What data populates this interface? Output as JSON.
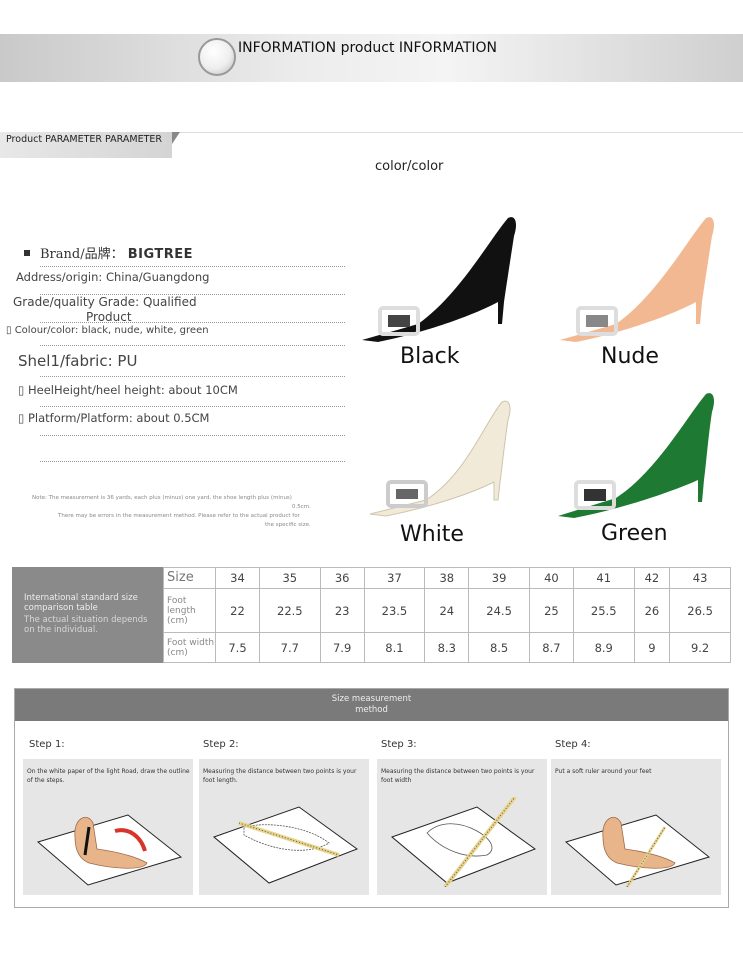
{
  "banner": {
    "title": "INFORMATION product INFORMATION"
  },
  "parameter_tab": {
    "label": "Product PARAMETER PARAMETER"
  },
  "color_heading": "color/color",
  "params": {
    "brand_label": "Brand/品牌：",
    "brand_value": "BIGTREE",
    "address": "Address/origin: China/Guangdong",
    "grade_line1": "Grade/quality Grade: Qualified",
    "grade_line2": "Product",
    "colour": "Colour/color: black, nude, white, green",
    "fabric": "Shel1/fabric: PU",
    "heel": "HeelHeight/heel height: about 10CM",
    "platform": "Platform/Platform: about 0.5CM"
  },
  "notes": {
    "line1": "Note: The measurement is 36 yards, each plus (minus) one yard, the shoe length plus (minus)",
    "line2": "0.5cm.",
    "line3": "There may be errors in the measurement method. Please refer to the actual product for",
    "line4": "the specific size."
  },
  "shoes": [
    {
      "label": "Black",
      "color": "#111111"
    },
    {
      "label": "Nude",
      "color": "#f2b892"
    },
    {
      "label": "White",
      "color": "#f2ead8"
    },
    {
      "label": "Green",
      "color": "#1e7a32"
    }
  ],
  "size_table": {
    "left_title": "International standard size comparison table",
    "left_note": "The actual situation depends on the individual.",
    "size_header": "Size",
    "length_header": "Foot length (cm)",
    "width_header": "Foot width (cm)",
    "sizes": [
      "34",
      "35",
      "36",
      "37",
      "38",
      "39",
      "40",
      "41",
      "42",
      "43"
    ],
    "lengths": [
      "22",
      "22.5",
      "23",
      "23.5",
      "24",
      "24.5",
      "25",
      "25.5",
      "26",
      "26.5"
    ],
    "widths": [
      "7.5",
      "7.7",
      "7.9",
      "8.1",
      "8.3",
      "8.5",
      "8.7",
      "8.9",
      "9",
      "9.2"
    ]
  },
  "measurement": {
    "title_line1": "Size measurement",
    "title_line2": "method",
    "steps": [
      {
        "label": "Step 1:",
        "desc": "On the white paper of the light Road, draw the outline of the steps."
      },
      {
        "label": "Step 2:",
        "desc": "Measuring the distance between two points is your foot length."
      },
      {
        "label": "Step 3:",
        "desc": "Measuring the distance between two points is your foot width"
      },
      {
        "label": "Step 4:",
        "desc": "Put a soft ruler around your feet"
      }
    ]
  }
}
